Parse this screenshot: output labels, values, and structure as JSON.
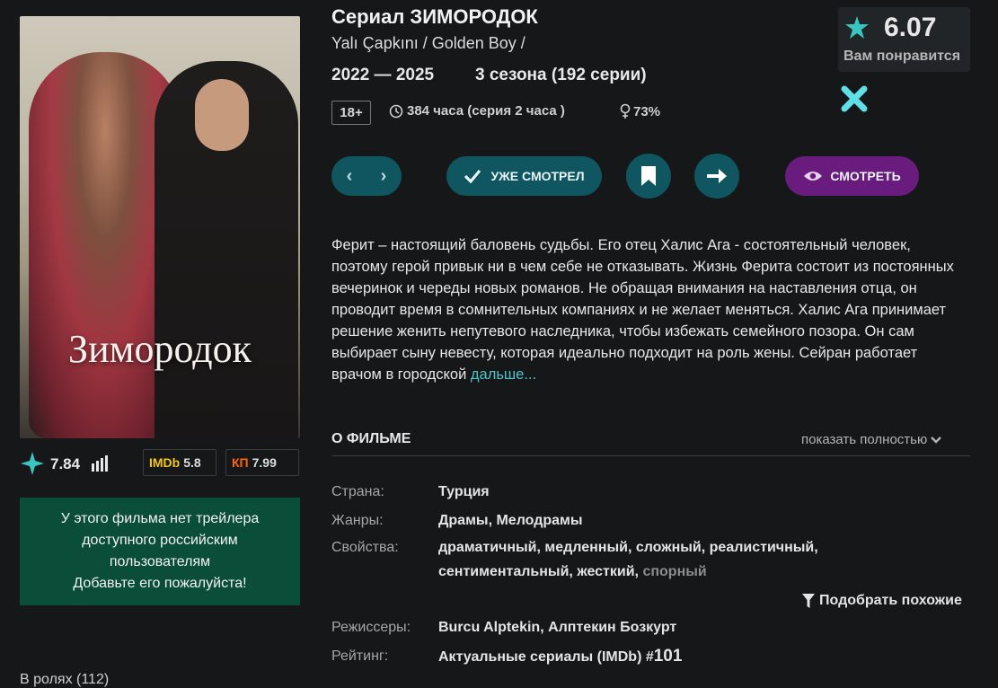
{
  "poster": {
    "title": "Зимородок"
  },
  "ratings": {
    "site": "7.84",
    "imdb_label": "IMDb",
    "imdb": "5.8",
    "kp_label": "КП",
    "kp": "7.99"
  },
  "trailer": {
    "line1": "У этого фильма нет трейлера",
    "line2": "доступного российским",
    "line3": "пользователям",
    "line4": "Добавьте его пожалуйста!"
  },
  "cast": "В ролях (112)",
  "header": {
    "title": "Сериал ЗИМОРОДОК",
    "alt_titles": "Yalı Çapkını / Golden Boy /",
    "years": "2022 — 2025",
    "seasons": "3 сезона (192 серии)",
    "age": "18+",
    "duration": "384 часа  (серия 2 часа )",
    "female_share": "73%"
  },
  "score_box": {
    "score": "6.07",
    "label": "Вам понравится"
  },
  "actions": {
    "prev": "‹",
    "next": "›",
    "seen": "УЖЕ СМОТРЕЛ",
    "watch": "СМОТРЕТЬ"
  },
  "description": {
    "text": "Ферит – настоящий баловень судьбы. Его отец Халис Ага - состоятельный человек, поэтому герой привык ни в чем себе не отказывать. Жизнь Ферита состоит из постоянных вечеринок и череды новых романов. Не обращая внимания на наставления отца, он проводит время в сомнительных компаниях и не желает меняться. Халис Ага принимает решение женить непутевого наследника, чтобы избежать семейного позора. Он сам выбирает сыну невесту, которая идеально подходит на роль жены. Сейран работает врачом в городской",
    "more": "дальше..."
  },
  "about": {
    "heading": "О ФИЛЬМЕ",
    "show_full": "показать полностью",
    "country_label": "Страна:",
    "country": "Турция",
    "genres_label": "Жанры:",
    "genres": "Драмы,  Мелодрамы",
    "props_label": "Свойства:",
    "props_line1": "драматичный,  медленный,  сложный,  реалистичный,",
    "props_line2a": "сентиментальный,  жесткий,",
    "props_line2b": "спорный",
    "similar": "Подобрать похожие",
    "directors_label": "Режиссеры:",
    "directors": "Burcu Alptekin,  Алптекин Бозкурт",
    "rating_label": "Рейтинг:",
    "rating_text": "Актуальные сериалы (IMDb) #",
    "rating_rank": "101"
  },
  "colors": {
    "background": "#151719",
    "accent_teal": "#0f5661",
    "accent_purple": "#6a1c7e",
    "trailer_bg": "#0a4e3a",
    "link": "#4fc3c8"
  }
}
